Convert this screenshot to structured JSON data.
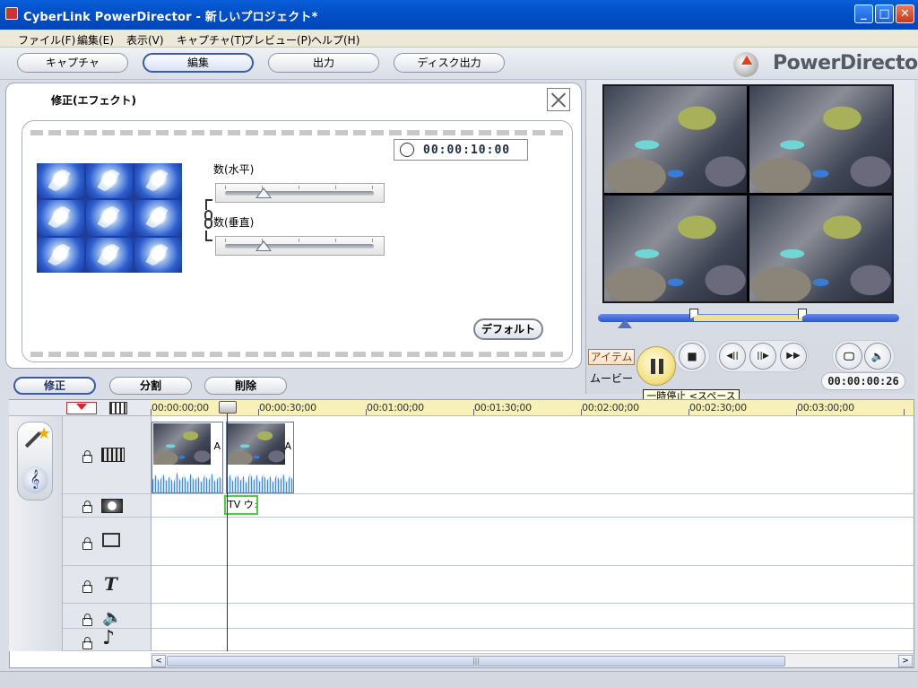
{
  "window": {
    "title": "CyberLink PowerDirector - 新しいプロジェクト*",
    "min_label": "_",
    "max_label": "□",
    "close_label": "✕"
  },
  "menu": [
    "ファイル(F)",
    "編集(E)",
    "表示(V)",
    "キャプチャ(T)",
    "プレビュー(P)",
    "ヘルプ(H)"
  ],
  "modes": {
    "capture": "キャプチャ",
    "edit": "編集",
    "output": "出力",
    "disc": "ディスク出力",
    "active": "edit"
  },
  "brand": "PowerDirector",
  "effect_panel": {
    "title": "修正(エフェクト)",
    "duration": "00:00:10:00",
    "slider_h_label": "数(水平)",
    "slider_h_value": 0.26,
    "slider_v_label": "数(垂直)",
    "slider_v_value": 0.26,
    "default_button": "デフォルト"
  },
  "edit_tabs": {
    "modify": "修正",
    "split": "分割",
    "delete": "削除"
  },
  "preview": {
    "item_button": "アイテム",
    "movie_button": "ムービー",
    "tooltip": "一時停止 <スペース>",
    "timecode": "00:00:00:26",
    "stop_icon": "■",
    "prev_frame_icon": "◀||",
    "next_frame_icon": "||▶",
    "fast_forward_icon": "▶▶",
    "monitor_icon": "🖵",
    "volume_icon": "🔈"
  },
  "timeline": {
    "ruler": [
      "00:00:00;00",
      "00:00:30;00",
      "00:01:00;00",
      "00:01:30;00",
      "00:02:00;00",
      "00:02:30;00",
      "00:03:00;00"
    ],
    "clip_label": "A",
    "fx_clip_label": "TV ウォ",
    "track_icons": {
      "video": "film-icon",
      "effect": "effect-icon",
      "pip": "monitor-icon",
      "title": "T",
      "voice": "🔈",
      "music": "♪"
    },
    "scroll_label": "|||",
    "scroll_left": "<",
    "scroll_right": ">"
  },
  "colors": {
    "accent": "#3c5aa8",
    "ruler_bg": "#f7f0b9",
    "scrub_range": "#f2e08a"
  }
}
